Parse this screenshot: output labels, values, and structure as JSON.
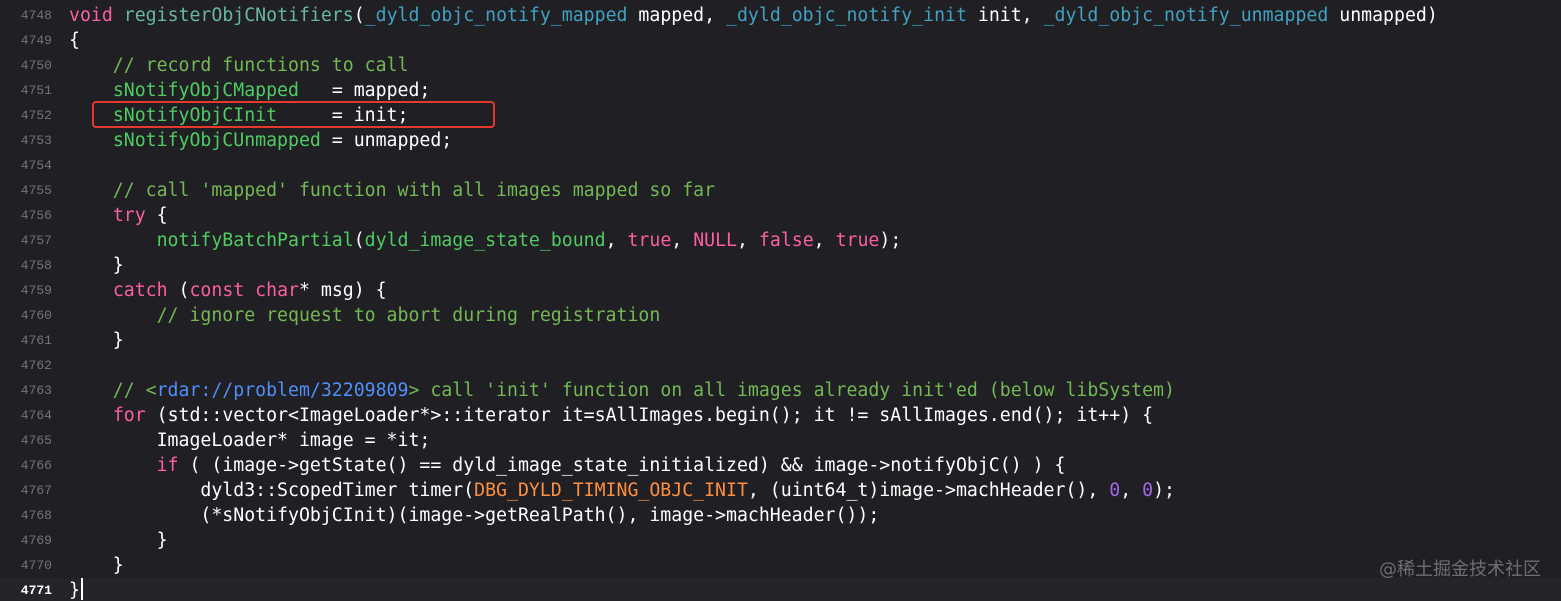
{
  "editor": {
    "colors": {
      "background": "#1f1f24",
      "current_line": "#23252b",
      "highlight_box": "#e5392e"
    },
    "lines": [
      {
        "number": "4748",
        "tokens": [
          [
            "kw",
            "void"
          ],
          [
            "plain",
            " "
          ],
          [
            "fn",
            "registerObjCNotifiers"
          ],
          [
            "plain",
            "("
          ],
          [
            "gl",
            "_dyld_objc_notify_mapped"
          ],
          [
            "plain",
            " mapped, "
          ],
          [
            "gl",
            "_dyld_objc_notify_init"
          ],
          [
            "plain",
            " init, "
          ],
          [
            "gl",
            "_dyld_objc_notify_unmapped"
          ],
          [
            "plain",
            " unmapped)"
          ]
        ]
      },
      {
        "number": "4749",
        "tokens": [
          [
            "plain",
            "{"
          ]
        ]
      },
      {
        "number": "4750",
        "tokens": [
          [
            "cmg",
            "    // record functions to call"
          ]
        ]
      },
      {
        "number": "4751",
        "tokens": [
          [
            "plain",
            "    "
          ],
          [
            "grn",
            "sNotifyObjCMapped"
          ],
          [
            "plain",
            "   = mapped;"
          ]
        ]
      },
      {
        "number": "4752",
        "tokens": [
          [
            "plain",
            "    "
          ],
          [
            "grn",
            "sNotifyObjCInit"
          ],
          [
            "plain",
            "     = init;"
          ]
        ]
      },
      {
        "number": "4753",
        "tokens": [
          [
            "plain",
            "    "
          ],
          [
            "grn",
            "sNotifyObjCUnmapped"
          ],
          [
            "plain",
            " = unmapped;"
          ]
        ]
      },
      {
        "number": "4754",
        "tokens": []
      },
      {
        "number": "4755",
        "tokens": [
          [
            "cmg",
            "    // call 'mapped' function with all images mapped so far"
          ]
        ]
      },
      {
        "number": "4756",
        "tokens": [
          [
            "plain",
            "    "
          ],
          [
            "kw",
            "try"
          ],
          [
            "plain",
            " {"
          ]
        ]
      },
      {
        "number": "4757",
        "tokens": [
          [
            "plain",
            "        "
          ],
          [
            "grn",
            "notifyBatchPartial"
          ],
          [
            "plain",
            "("
          ],
          [
            "grn",
            "dyld_image_state_bound"
          ],
          [
            "plain",
            ", "
          ],
          [
            "kw",
            "true"
          ],
          [
            "plain",
            ", "
          ],
          [
            "kw",
            "NULL"
          ],
          [
            "plain",
            ", "
          ],
          [
            "kw",
            "false"
          ],
          [
            "plain",
            ", "
          ],
          [
            "kw",
            "true"
          ],
          [
            "plain",
            ");"
          ]
        ]
      },
      {
        "number": "4758",
        "tokens": [
          [
            "plain",
            "    }"
          ]
        ]
      },
      {
        "number": "4759",
        "tokens": [
          [
            "plain",
            "    "
          ],
          [
            "kw",
            "catch"
          ],
          [
            "plain",
            " ("
          ],
          [
            "kw",
            "const"
          ],
          [
            "plain",
            " "
          ],
          [
            "kw",
            "char"
          ],
          [
            "plain",
            "* msg) {"
          ]
        ]
      },
      {
        "number": "4760",
        "tokens": [
          [
            "cmg",
            "        // ignore request to abort during registration"
          ]
        ]
      },
      {
        "number": "4761",
        "tokens": [
          [
            "plain",
            "    }"
          ]
        ]
      },
      {
        "number": "4762",
        "tokens": []
      },
      {
        "number": "4763",
        "tokens": [
          [
            "cmg",
            "    // <"
          ],
          [
            "link",
            "rdar://problem/32209809"
          ],
          [
            "cmg",
            "> call 'init' function on all images already init'ed (below libSystem)"
          ]
        ]
      },
      {
        "number": "4764",
        "tokens": [
          [
            "plain",
            "    "
          ],
          [
            "kw",
            "for"
          ],
          [
            "plain",
            " (std::vector<ImageLoader*>::iterator it=sAllImages.begin(); it != sAllImages.end(); it++) {"
          ]
        ]
      },
      {
        "number": "4765",
        "tokens": [
          [
            "plain",
            "        ImageLoader* image = *it;"
          ]
        ]
      },
      {
        "number": "4766",
        "tokens": [
          [
            "plain",
            "        "
          ],
          [
            "kw",
            "if"
          ],
          [
            "plain",
            " ( (image->getState() == dyld_image_state_initialized) && image->notifyObjC() ) {"
          ]
        ]
      },
      {
        "number": "4767",
        "tokens": [
          [
            "plain",
            "            dyld3::ScopedTimer timer("
          ],
          [
            "mac",
            "DBG_DYLD_TIMING_OBJC_INIT"
          ],
          [
            "plain",
            ", (uint64_t)image->machHeader(), "
          ],
          [
            "num2",
            "0"
          ],
          [
            "plain",
            ", "
          ],
          [
            "num2",
            "0"
          ],
          [
            "plain",
            ");"
          ]
        ]
      },
      {
        "number": "4768",
        "tokens": [
          [
            "plain",
            "            (*sNotifyObjCInit)(image->getRealPath(), image->machHeader());"
          ]
        ]
      },
      {
        "number": "4769",
        "tokens": [
          [
            "plain",
            "        }"
          ]
        ]
      },
      {
        "number": "4770",
        "tokens": [
          [
            "plain",
            "    }"
          ]
        ]
      },
      {
        "number": "4771",
        "tokens": [
          [
            "plain",
            "}"
          ]
        ],
        "current": true
      }
    ]
  },
  "watermark": "@稀土掘金技术社区"
}
